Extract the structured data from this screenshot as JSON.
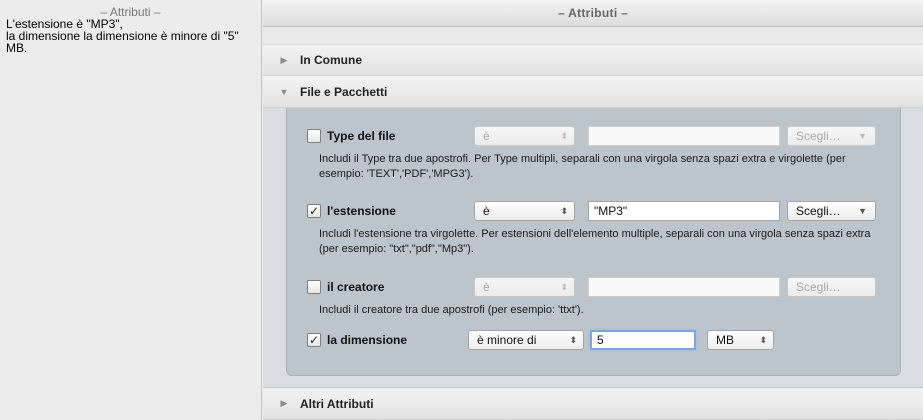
{
  "left": {
    "title": "– Attributi –",
    "summary": "L'estensione è \"MP3\",\nla dimensione la dimensione è minore di \"5\" MB."
  },
  "right": {
    "title": "– Attributi –",
    "sections": {
      "in_comune": "In Comune",
      "file_pacchetti": "File e Pacchetti",
      "altri_attributi": "Altri Attributi"
    },
    "criteria": {
      "type": {
        "label": "Type del file",
        "checked": false,
        "operator": "è",
        "value": "",
        "choose": "Scegli…",
        "help": "Includi il Type tra due apostrofi. Per Type multipli, separali con una virgola senza spazi extra e virgolette (per esempio: 'TEXT','PDF','MPG3')."
      },
      "extension": {
        "label": "l'estensione",
        "checked": true,
        "operator": "è",
        "value": "\"MP3\"",
        "choose": "Scegli…",
        "help": "Includi l'estensione tra virgolette. Per estensioni dell'elemento multiple, separali con una virgola senza spazi extra (per esempio: \"txt\",\"pdf\",\"Mp3\")."
      },
      "creator": {
        "label": "il creatore",
        "checked": false,
        "operator": "è",
        "value": "",
        "choose": "Scegli…",
        "help": "Includi il creatore tra due apostrofi (per esempio: 'ttxt')."
      },
      "size": {
        "label": "la dimensione",
        "checked": true,
        "operator": "è minore di",
        "value": "5",
        "unit": "MB"
      }
    }
  },
  "icons": {
    "checkmark": "✓",
    "triangle_right": "▶",
    "triangle_down": "▼",
    "updown": "⌃⌄",
    "dropdown": "▼"
  }
}
